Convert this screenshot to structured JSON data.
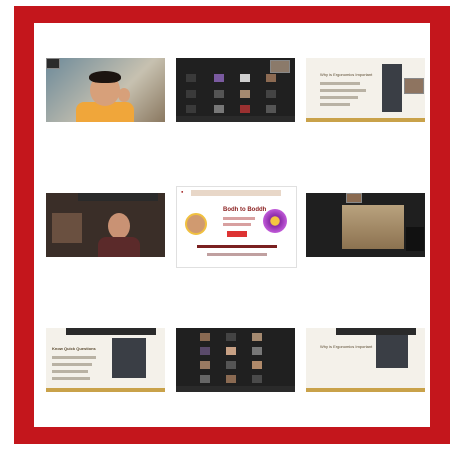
{
  "window": {
    "title": ""
  },
  "tiles": [
    {
      "name": "speaker-video-tile",
      "kind": "video"
    },
    {
      "name": "gallery-view-tile-1",
      "kind": "gallery"
    },
    {
      "name": "slide-share-tile-1",
      "kind": "slide",
      "slide_title": "Why is Ergonomics Important"
    },
    {
      "name": "presenter-video-tile",
      "kind": "video"
    },
    {
      "name": "event-poster-tile",
      "kind": "poster",
      "poster_title": "Bodh to Boddh"
    },
    {
      "name": "screen-share-tile",
      "kind": "screen"
    },
    {
      "name": "slide-share-tile-2",
      "kind": "slide",
      "slide_title": "Know Quick Questions"
    },
    {
      "name": "gallery-view-tile-2",
      "kind": "gallery"
    },
    {
      "name": "slide-share-tile-3",
      "kind": "slide",
      "slide_title": "Why is Ergonomics Important"
    }
  ],
  "colors": {
    "frame": "#c4161c",
    "background": "#ffffff",
    "tile": "#1f1f1f",
    "accent": "#c9a24a"
  }
}
